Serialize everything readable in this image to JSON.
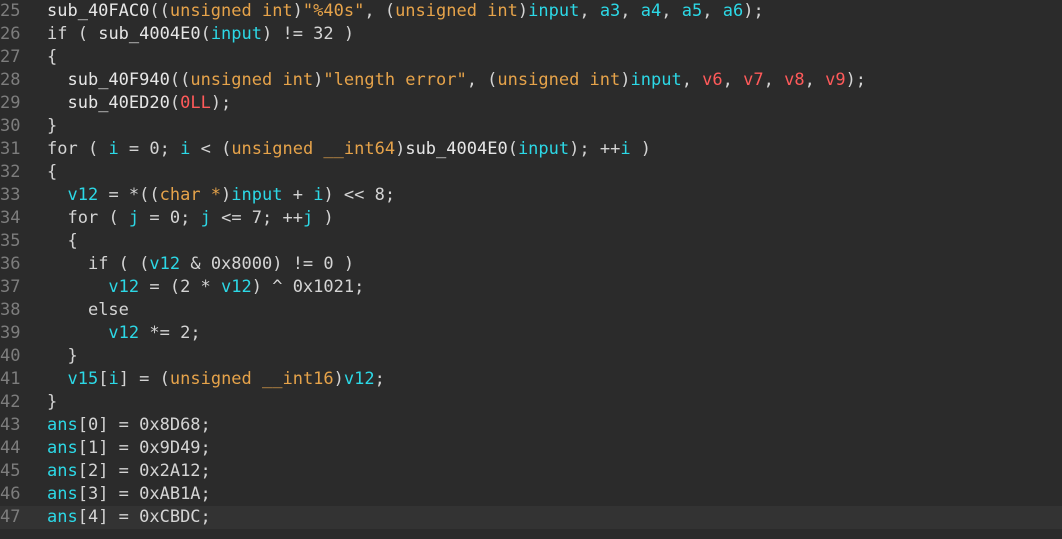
{
  "editor": {
    "lines": [
      {
        "n": "25",
        "tokens": [
          [
            "fn",
            "sub_40FAC0"
          ],
          [
            "p",
            "(("
          ],
          [
            "type",
            "unsigned int"
          ],
          [
            "p",
            ")"
          ],
          [
            "str",
            "\"%40s\""
          ],
          [
            "p",
            ", ("
          ],
          [
            "type",
            "unsigned int"
          ],
          [
            "p",
            ")"
          ],
          [
            "var",
            "input"
          ],
          [
            "p",
            ", "
          ],
          [
            "var",
            "a3"
          ],
          [
            "p",
            ", "
          ],
          [
            "var",
            "a4"
          ],
          [
            "p",
            ", "
          ],
          [
            "var",
            "a5"
          ],
          [
            "p",
            ", "
          ],
          [
            "var",
            "a6"
          ],
          [
            "p",
            ");"
          ]
        ]
      },
      {
        "n": "26",
        "tokens": [
          [
            "kw",
            "if"
          ],
          [
            "p",
            " ( "
          ],
          [
            "fn",
            "sub_4004E0"
          ],
          [
            "p",
            "("
          ],
          [
            "var",
            "input"
          ],
          [
            "p",
            ") != 32 )"
          ]
        ]
      },
      {
        "n": "27",
        "tokens": [
          [
            "p",
            "{"
          ]
        ]
      },
      {
        "n": "28",
        "tokens": [
          [
            "p",
            "  "
          ],
          [
            "fn",
            "sub_40F940"
          ],
          [
            "p",
            "(("
          ],
          [
            "type",
            "unsigned int"
          ],
          [
            "p",
            ")"
          ],
          [
            "str",
            "\"length error\""
          ],
          [
            "p",
            ", ("
          ],
          [
            "type",
            "unsigned int"
          ],
          [
            "p",
            ")"
          ],
          [
            "var",
            "input"
          ],
          [
            "p",
            ", "
          ],
          [
            "arg",
            "v6"
          ],
          [
            "p",
            ", "
          ],
          [
            "arg",
            "v7"
          ],
          [
            "p",
            ", "
          ],
          [
            "arg",
            "v8"
          ],
          [
            "p",
            ", "
          ],
          [
            "arg",
            "v9"
          ],
          [
            "p",
            ");"
          ]
        ]
      },
      {
        "n": "29",
        "tokens": [
          [
            "p",
            "  "
          ],
          [
            "fn",
            "sub_40ED20"
          ],
          [
            "p",
            "("
          ],
          [
            "arg",
            "0LL"
          ],
          [
            "p",
            ");"
          ]
        ]
      },
      {
        "n": "30",
        "tokens": [
          [
            "p",
            "}"
          ]
        ]
      },
      {
        "n": "31",
        "tokens": [
          [
            "kw",
            "for"
          ],
          [
            "p",
            " ( "
          ],
          [
            "var",
            "i"
          ],
          [
            "p",
            " = 0; "
          ],
          [
            "var",
            "i"
          ],
          [
            "p",
            " < ("
          ],
          [
            "type",
            "unsigned __int64"
          ],
          [
            "p",
            ")"
          ],
          [
            "fn",
            "sub_4004E0"
          ],
          [
            "p",
            "("
          ],
          [
            "var",
            "input"
          ],
          [
            "p",
            "); ++"
          ],
          [
            "var",
            "i"
          ],
          [
            "p",
            " )"
          ]
        ]
      },
      {
        "n": "32",
        "tokens": [
          [
            "p",
            "{"
          ]
        ]
      },
      {
        "n": "33",
        "tokens": [
          [
            "p",
            "  "
          ],
          [
            "var",
            "v12"
          ],
          [
            "p",
            " = *(("
          ],
          [
            "type",
            "char *"
          ],
          [
            "p",
            ")"
          ],
          [
            "var",
            "input"
          ],
          [
            "p",
            " + "
          ],
          [
            "var",
            "i"
          ],
          [
            "p",
            ") << 8;"
          ]
        ]
      },
      {
        "n": "34",
        "tokens": [
          [
            "p",
            "  "
          ],
          [
            "kw",
            "for"
          ],
          [
            "p",
            " ( "
          ],
          [
            "var",
            "j"
          ],
          [
            "p",
            " = 0; "
          ],
          [
            "var",
            "j"
          ],
          [
            "p",
            " <= 7; ++"
          ],
          [
            "var",
            "j"
          ],
          [
            "p",
            " )"
          ]
        ]
      },
      {
        "n": "35",
        "tokens": [
          [
            "p",
            "  {"
          ]
        ]
      },
      {
        "n": "36",
        "tokens": [
          [
            "p",
            "    "
          ],
          [
            "kw",
            "if"
          ],
          [
            "p",
            " ( ("
          ],
          [
            "var",
            "v12"
          ],
          [
            "p",
            " & 0x8000) != 0 )"
          ]
        ]
      },
      {
        "n": "37",
        "tokens": [
          [
            "p",
            "      "
          ],
          [
            "var",
            "v12"
          ],
          [
            "p",
            " = (2 * "
          ],
          [
            "var",
            "v12"
          ],
          [
            "p",
            ") ^ 0x1021;"
          ]
        ]
      },
      {
        "n": "38",
        "tokens": [
          [
            "p",
            "    "
          ],
          [
            "kw",
            "else"
          ]
        ]
      },
      {
        "n": "39",
        "tokens": [
          [
            "p",
            "      "
          ],
          [
            "var",
            "v12"
          ],
          [
            "p",
            " *= 2;"
          ]
        ]
      },
      {
        "n": "40",
        "tokens": [
          [
            "p",
            "  }"
          ]
        ]
      },
      {
        "n": "41",
        "tokens": [
          [
            "p",
            "  "
          ],
          [
            "var",
            "v15"
          ],
          [
            "p",
            "["
          ],
          [
            "var",
            "i"
          ],
          [
            "p",
            "] = ("
          ],
          [
            "type",
            "unsigned __int16"
          ],
          [
            "p",
            ")"
          ],
          [
            "var",
            "v12"
          ],
          [
            "p",
            ";"
          ]
        ]
      },
      {
        "n": "42",
        "tokens": [
          [
            "p",
            "}"
          ]
        ]
      },
      {
        "n": "43",
        "tokens": [
          [
            "var",
            "ans"
          ],
          [
            "p",
            "[0] = 0x8D68;"
          ]
        ]
      },
      {
        "n": "44",
        "tokens": [
          [
            "var",
            "ans"
          ],
          [
            "p",
            "[1] = 0x9D49;"
          ]
        ]
      },
      {
        "n": "45",
        "tokens": [
          [
            "var",
            "ans"
          ],
          [
            "p",
            "[2] = 0x2A12;"
          ]
        ]
      },
      {
        "n": "46",
        "tokens": [
          [
            "var",
            "ans"
          ],
          [
            "p",
            "[3] = 0xAB1A;"
          ]
        ]
      },
      {
        "n": "47",
        "tokens": [
          [
            "var",
            "ans"
          ],
          [
            "p",
            "[4] = 0xCBDC;"
          ]
        ],
        "current": true
      }
    ]
  },
  "colors": {
    "background": "#2b2b2b",
    "current_line": "#333333",
    "line_number": "#7d7d7d",
    "identifier": "#2cd8e6",
    "string_type": "#e6a34a",
    "argument": "#ff5a5a",
    "text": "#d4d4d4"
  }
}
